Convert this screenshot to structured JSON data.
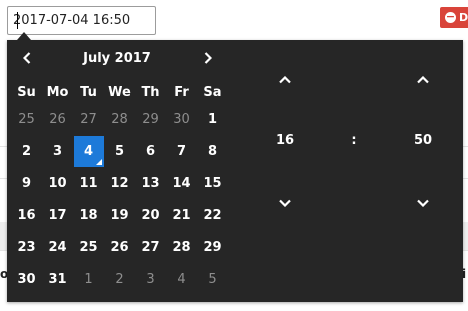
{
  "datetime_input": {
    "value": "2017-07-04 16:50"
  },
  "delete_button": {
    "label": "D"
  },
  "calendar": {
    "month_label": "July 2017",
    "weekdays": [
      "Su",
      "Mo",
      "Tu",
      "We",
      "Th",
      "Fr",
      "Sa"
    ],
    "weeks": [
      [
        {
          "d": "25",
          "other": true
        },
        {
          "d": "26",
          "other": true
        },
        {
          "d": "27",
          "other": true
        },
        {
          "d": "28",
          "other": true
        },
        {
          "d": "29",
          "other": true
        },
        {
          "d": "30",
          "other": true
        },
        {
          "d": "1",
          "other": false
        }
      ],
      [
        {
          "d": "2",
          "other": false
        },
        {
          "d": "3",
          "other": false
        },
        {
          "d": "4",
          "other": false,
          "selected": true
        },
        {
          "d": "5",
          "other": false
        },
        {
          "d": "6",
          "other": false
        },
        {
          "d": "7",
          "other": false
        },
        {
          "d": "8",
          "other": false
        }
      ],
      [
        {
          "d": "9",
          "other": false
        },
        {
          "d": "10",
          "other": false
        },
        {
          "d": "11",
          "other": false
        },
        {
          "d": "12",
          "other": false
        },
        {
          "d": "13",
          "other": false
        },
        {
          "d": "14",
          "other": false
        },
        {
          "d": "15",
          "other": false
        }
      ],
      [
        {
          "d": "16",
          "other": false
        },
        {
          "d": "17",
          "other": false
        },
        {
          "d": "18",
          "other": false
        },
        {
          "d": "19",
          "other": false
        },
        {
          "d": "20",
          "other": false
        },
        {
          "d": "21",
          "other": false
        },
        {
          "d": "22",
          "other": false
        }
      ],
      [
        {
          "d": "23",
          "other": false
        },
        {
          "d": "24",
          "other": false
        },
        {
          "d": "25",
          "other": false
        },
        {
          "d": "26",
          "other": false
        },
        {
          "d": "27",
          "other": false
        },
        {
          "d": "28",
          "other": false
        },
        {
          "d": "29",
          "other": false
        }
      ],
      [
        {
          "d": "30",
          "other": false
        },
        {
          "d": "31",
          "other": false
        },
        {
          "d": "1",
          "other": true
        },
        {
          "d": "2",
          "other": true
        },
        {
          "d": "3",
          "other": true
        },
        {
          "d": "4",
          "other": true
        },
        {
          "d": "5",
          "other": true
        }
      ]
    ]
  },
  "time": {
    "hour": "16",
    "separator": ":",
    "minute": "50"
  },
  "background": {
    "edge_left_text": "o",
    "edge_right_text": "i"
  },
  "colors": {
    "picker_bg": "#262626",
    "selected_day": "#1d7ad9",
    "delete_button": "#d9443a"
  },
  "icons": {
    "prev": "chevron-left-icon",
    "next": "chevron-right-icon",
    "up": "chevron-up-icon",
    "down": "chevron-down-icon",
    "delete": "minus-circle-icon"
  }
}
